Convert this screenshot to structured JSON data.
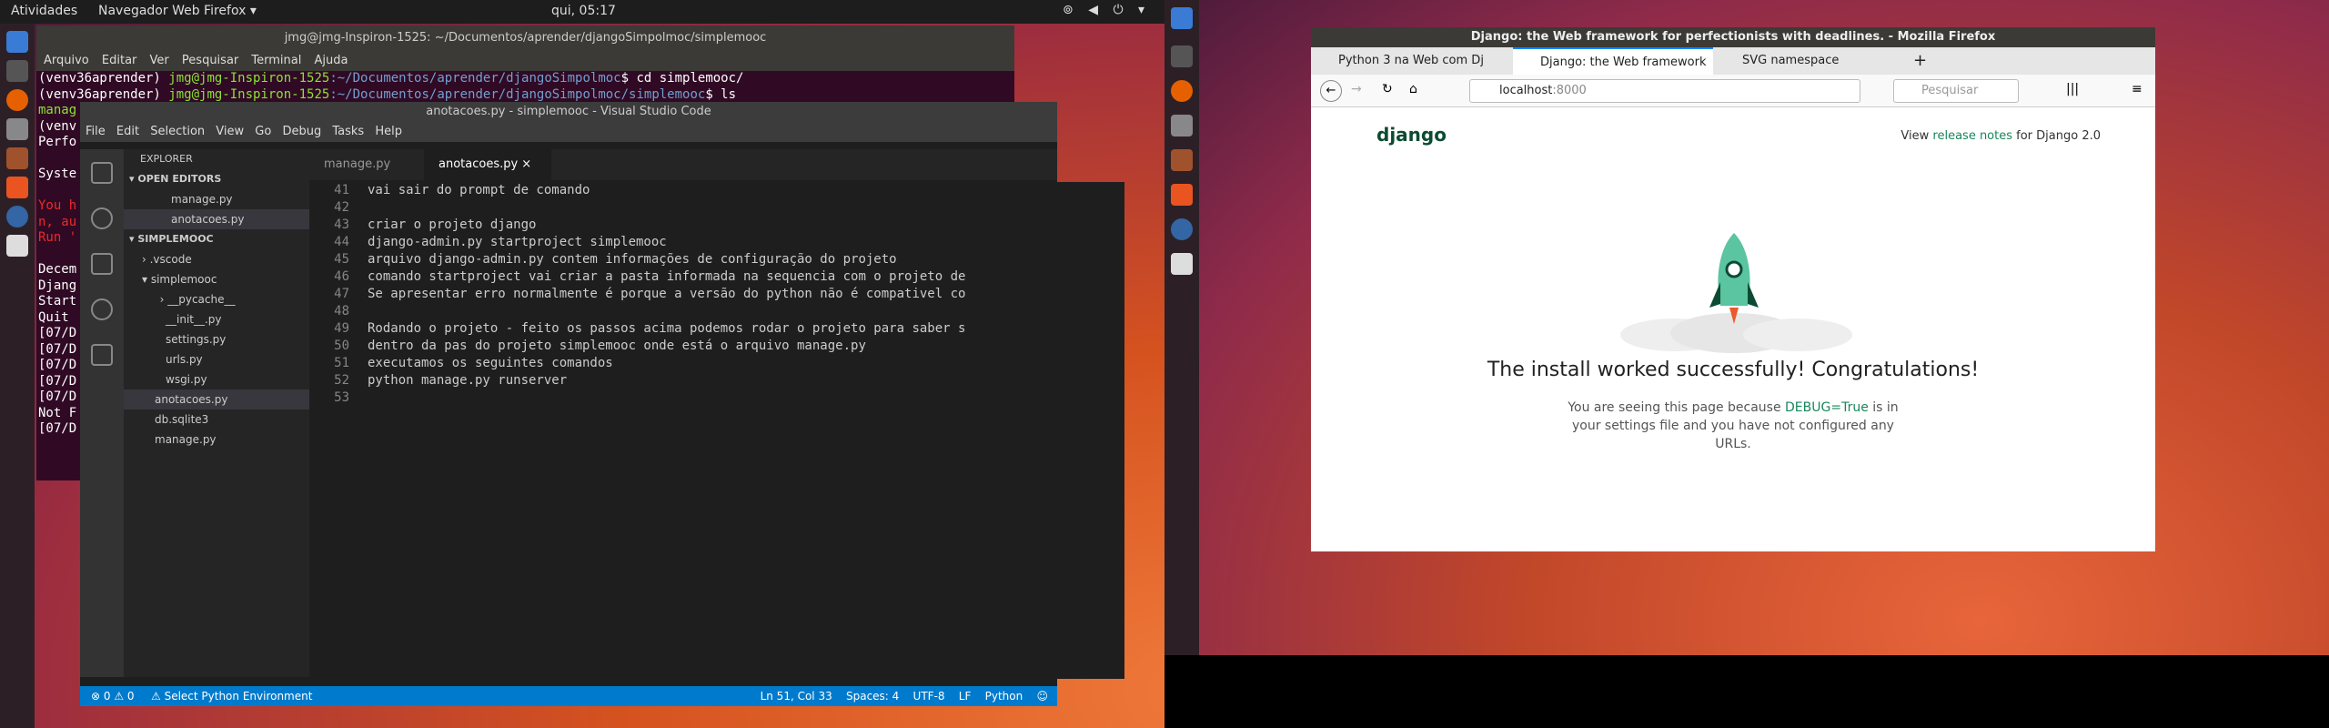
{
  "topbar": {
    "activities": "Atividades",
    "app": "Navegador Web Firefox ▾",
    "clock": "qui, 05:17",
    "tray": "⊚ ◀ ⏻ ▾"
  },
  "terminal": {
    "title": "jmg@jmg-Inspiron-1525: ~/Documentos/aprender/djangoSimpolmoc/simplemooc",
    "menu": [
      "Arquivo",
      "Editar",
      "Ver",
      "Pesquisar",
      "Terminal",
      "Ajuda"
    ],
    "prompt1_env": "(venv36aprender) ",
    "prompt1_user": "jmg@jmg-Inspiron-1525",
    "prompt1_path": ":~/Documentos/aprender/djangoSimpolmoc",
    "prompt1_cmd": "$ cd simplemooc/",
    "prompt2_env": "(venv36aprender) ",
    "prompt2_user": "jmg@jmg-Inspiron-1525",
    "prompt2_path": ":~/Documentos/aprender/djangoSimpolmoc/simplemooc",
    "prompt2_cmd": "$ ls",
    "lines": [
      "manag",
      "(venv",
      "Perfo",
      "",
      "Syste",
      "",
      "You h",
      "n, au",
      "Run '",
      "",
      "Decem",
      "Djang",
      "Start",
      "Quit ",
      "[07/D",
      "[07/D",
      "[07/D",
      "[07/D",
      "[07/D",
      "Not F",
      "[07/D"
    ]
  },
  "vscode": {
    "title": "anotacoes.py - simplemooc - Visual Studio Code",
    "menu": [
      "File",
      "Edit",
      "Selection",
      "View",
      "Go",
      "Debug",
      "Tasks",
      "Help"
    ],
    "explorer": "EXPLORER",
    "open_editors": "▾ OPEN EDITORS",
    "open_files": [
      "manage.py",
      "anotacoes.py"
    ],
    "project": "▾ SIMPLEMOOC",
    "tree": [
      "› .vscode",
      "▾ simplemooc",
      "  › __pycache__",
      "  __init__.py",
      "  settings.py",
      "  urls.py",
      "  wsgi.py",
      "anotacoes.py",
      "db.sqlite3",
      "manage.py"
    ],
    "tabs": [
      "manage.py",
      "anotacoes.py ×"
    ],
    "code": [
      {
        "n": "41",
        "t": "vai sair do prompt de comando"
      },
      {
        "n": "42",
        "t": ""
      },
      {
        "n": "43",
        "t": "criar o projeto django"
      },
      {
        "n": "44",
        "t": "django-admin.py startproject simplemooc"
      },
      {
        "n": "45",
        "t": "arquivo django-admin.py contem informações de configuração do projeto"
      },
      {
        "n": "46",
        "t": "comando startproject vai criar a pasta informada na sequencia com o projeto de"
      },
      {
        "n": "47",
        "t": "Se apresentar erro normalmente é porque a versão do python não é compativel co"
      },
      {
        "n": "48",
        "t": ""
      },
      {
        "n": "49",
        "t": "Rodando o projeto - feito os passos acima podemos rodar o projeto para saber s"
      },
      {
        "n": "50",
        "t": "dentro da pas do projeto simplemooc onde está o arquivo manage.py"
      },
      {
        "n": "51",
        "t": "executamos os seguintes comandos"
      },
      {
        "n": "52",
        "t": "python manage.py runserver"
      },
      {
        "n": "53",
        "t": ""
      }
    ],
    "status_left": "⊗ 0 ⚠ 0",
    "status_python": "⚠ Select Python Environment",
    "status_right": "Ln 51, Col 33    Spaces: 4    UTF-8    LF    Python    ☺"
  },
  "firefox": {
    "title": "Django: the Web framework for perfectionists with deadlines. - Mozilla Firefox",
    "tabs": [
      "Python 3 na Web com Dj",
      "Django: the Web framework",
      "SVG namespace"
    ],
    "new_tab": "+",
    "url_host": "localhost",
    "url_port": ":8000",
    "search_placeholder": "Pesquisar",
    "logo": "django",
    "view_pre": "View ",
    "release_notes": "release notes",
    "view_post": " for Django 2.0",
    "headline": "The install worked successfully! Congratulations!",
    "desc_pre": "You are seeing this page because ",
    "debug": "DEBUG=True",
    "desc_post": " is in your settings file and you have not configured any URLs."
  },
  "colors": {
    "django_green": "#0c4b33",
    "link_green": "#19865c",
    "vscode_blue": "#007acc",
    "terminal_bg": "#300a24"
  }
}
